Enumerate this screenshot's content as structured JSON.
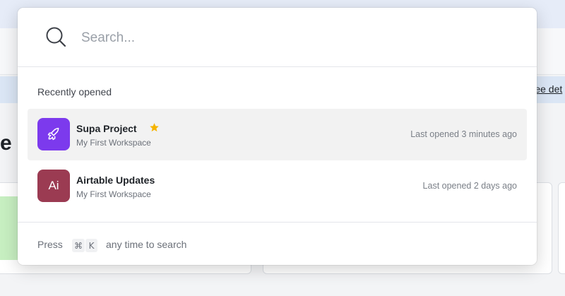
{
  "background": {
    "banner_link": "See det",
    "heading_fragment": "e"
  },
  "search": {
    "placeholder": "Search..."
  },
  "recent": {
    "title": "Recently opened",
    "items": [
      {
        "name": "Supa Project",
        "workspace": "My First Workspace",
        "time": "Last opened 3 minutes ago",
        "icon": "rocket-icon",
        "color": "#7c3aed",
        "starred": true,
        "selected": true
      },
      {
        "name": "Airtable Updates",
        "workspace": "My First Workspace",
        "time": "Last opened 2 days ago",
        "avatar_text": "Ai",
        "color": "#9b3b52",
        "starred": false,
        "selected": false
      }
    ]
  },
  "footer": {
    "press": "Press",
    "key_cmd": "⌘",
    "key_k": "K",
    "hint": "any time to search"
  },
  "colors": {
    "star": "#f5b400",
    "divider": "#e4e6ea"
  }
}
